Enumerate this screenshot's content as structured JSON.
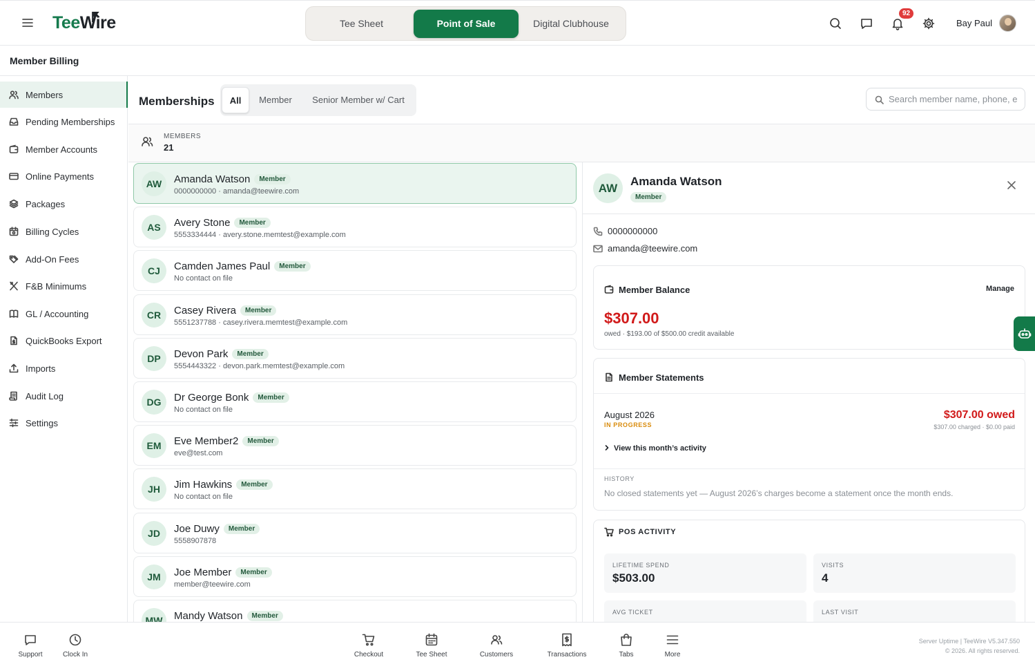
{
  "app": {
    "logo_tee": "Tee",
    "logo_wire": "Wire",
    "switcher": [
      "Tee Sheet",
      "Point of Sale",
      "Digital Clubhouse"
    ],
    "active_switch": "Point of Sale",
    "notification_count": "92",
    "user_name": "Bay Paul",
    "accent_color": "#137a49"
  },
  "page": {
    "title": "Member Billing"
  },
  "sidebar": {
    "items": [
      {
        "label": "Members",
        "icon": "users-icon",
        "active": true
      },
      {
        "label": "Pending Memberships",
        "icon": "inbox-icon"
      },
      {
        "label": "Member Accounts",
        "icon": "wallet-icon"
      },
      {
        "label": "Online Payments",
        "icon": "credit-card-icon"
      },
      {
        "label": "Packages",
        "icon": "layers-icon"
      },
      {
        "label": "Billing Cycles",
        "icon": "calendar-cycle-icon"
      },
      {
        "label": "Add-On Fees",
        "icon": "tags-icon"
      },
      {
        "label": "F&B Minimums",
        "icon": "utensils-icon"
      },
      {
        "label": "GL / Accounting",
        "icon": "book-icon"
      },
      {
        "label": "QuickBooks Export",
        "icon": "file-dollar-icon"
      },
      {
        "label": "Imports",
        "icon": "upload-icon"
      },
      {
        "label": "Audit Log",
        "icon": "scroll-icon"
      },
      {
        "label": "Settings",
        "icon": "sliders-icon"
      }
    ]
  },
  "main": {
    "title": "Memberships",
    "filters": [
      "All",
      "Member",
      "Senior Member w/ Cart"
    ],
    "active_filter": "All",
    "search_placeholder": "Search member name, phone, e",
    "count_label": "MEMBERS",
    "count_value": "21"
  },
  "members": [
    {
      "initials": "AW",
      "name": "Amanda Watson",
      "badge": "Member",
      "contact": "0000000000 · amanda@teewire.com",
      "selected": true
    },
    {
      "initials": "AS",
      "name": "Avery Stone",
      "badge": "Member",
      "contact": "5553334444 · avery.stone.memtest@example.com"
    },
    {
      "initials": "CJ",
      "name": "Camden James Paul",
      "badge": "Member",
      "contact": "No contact on file"
    },
    {
      "initials": "CR",
      "name": "Casey Rivera",
      "badge": "Member",
      "contact": "5551237788 · casey.rivera.memtest@example.com"
    },
    {
      "initials": "DP",
      "name": "Devon Park",
      "badge": "Member",
      "contact": "5554443322 · devon.park.memtest@example.com"
    },
    {
      "initials": "DG",
      "name": "Dr George Bonk",
      "badge": "Member",
      "contact": "No contact on file"
    },
    {
      "initials": "EM",
      "name": "Eve Member2",
      "badge": "Member",
      "contact": "eve@test.com"
    },
    {
      "initials": "JH",
      "name": "Jim Hawkins",
      "badge": "Member",
      "contact": "No contact on file"
    },
    {
      "initials": "JD",
      "name": "Joe Duwy",
      "badge": "Member",
      "contact": "5558907878"
    },
    {
      "initials": "JM",
      "name": "Joe Member",
      "badge": "Member",
      "contact": "member@teewire.com"
    },
    {
      "initials": "MW",
      "name": "Mandy Watson",
      "badge": "Member",
      "contact": ""
    }
  ],
  "detail": {
    "initials": "AW",
    "name": "Amanda Watson",
    "badge": "Member",
    "phone": "0000000000",
    "email": "amanda@teewire.com",
    "balance": {
      "title": "Member Balance",
      "manage_label": "Manage",
      "amount": "$307.00",
      "subtitle": "owed · $193.00 of $500.00 credit available"
    },
    "statements": {
      "title": "Member Statements",
      "period": "August 2026",
      "status": "IN PROGRESS",
      "owed": "$307.00 owed",
      "detail": "$307.00 charged · $0.00 paid",
      "view_label": "View this month’s activity",
      "history_label": "HISTORY",
      "history_text": "No closed statements yet — August 2026’s charges become a statement once the month ends."
    },
    "pos": {
      "title": "POS ACTIVITY",
      "stats": [
        {
          "label": "LIFETIME SPEND",
          "value": "$503.00"
        },
        {
          "label": "VISITS",
          "value": "4"
        },
        {
          "label": "AVG TICKET",
          "value": ""
        },
        {
          "label": "LAST VISIT",
          "value": ""
        }
      ]
    }
  },
  "bottom_nav": {
    "left": [
      {
        "label": "Support",
        "icon": "chat-icon"
      },
      {
        "label": "Clock In",
        "icon": "clock-icon"
      }
    ],
    "center": [
      {
        "label": "Checkout",
        "icon": "cart-icon"
      },
      {
        "label": "Tee Sheet",
        "icon": "calendar-icon"
      },
      {
        "label": "Customers",
        "icon": "users-icon"
      },
      {
        "label": "Transactions",
        "icon": "receipt-icon"
      },
      {
        "label": "Tabs",
        "icon": "bag-icon"
      },
      {
        "label": "More",
        "icon": "menu-icon"
      }
    ],
    "version_line1": "Server Uptime  |  TeeWire V5.347.550",
    "version_line2": "© 2026. All rights reserved."
  }
}
